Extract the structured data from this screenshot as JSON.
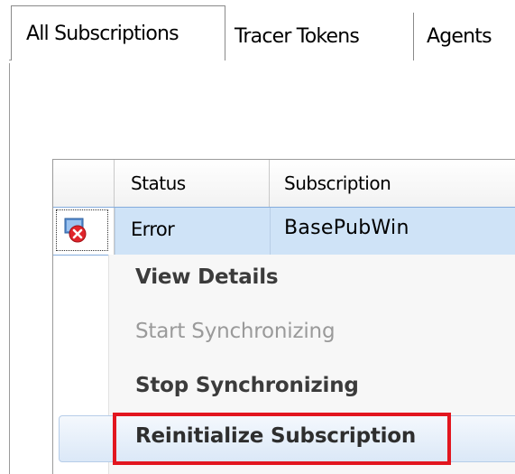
{
  "tabs": [
    {
      "label": "All Subscriptions",
      "active": true
    },
    {
      "label": "Tracer Tokens",
      "active": false
    },
    {
      "label": "Agents",
      "active": false
    }
  ],
  "grid": {
    "columns": [
      "",
      "Status",
      "Subscription"
    ],
    "rows": [
      {
        "icon": "error-icon",
        "status": "Error",
        "subscription": "BasePubWin"
      }
    ]
  },
  "context_menu": {
    "items": [
      {
        "label": "View Details",
        "enabled": true
      },
      {
        "label": "Start Synchronizing",
        "enabled": false
      },
      {
        "label": "Stop Synchronizing",
        "enabled": true
      },
      {
        "label": "Reinitialize Subscription",
        "enabled": true,
        "hovered": true
      }
    ]
  },
  "colors": {
    "selection": "#cfe3f7",
    "highlight_border": "#e2161f",
    "disabled_text": "#9a9a9a"
  }
}
